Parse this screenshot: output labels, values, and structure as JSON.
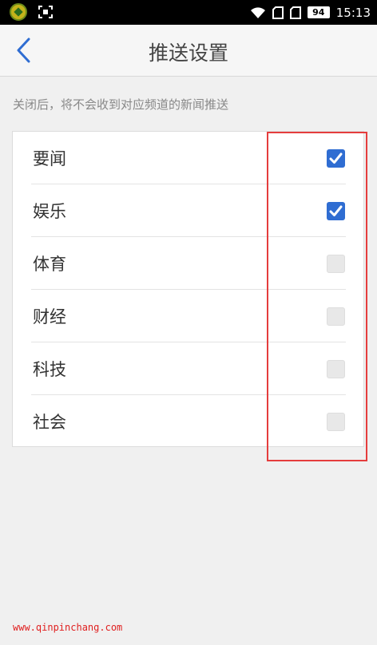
{
  "status_bar": {
    "battery": "94",
    "time": "15:13"
  },
  "header": {
    "title": "推送设置"
  },
  "hint": "关闭后，将不会收到对应频道的新闻推送",
  "channels": [
    {
      "label": "要闻",
      "checked": true
    },
    {
      "label": "娱乐",
      "checked": true
    },
    {
      "label": "体育",
      "checked": false
    },
    {
      "label": "财经",
      "checked": false
    },
    {
      "label": "科技",
      "checked": false
    },
    {
      "label": "社会",
      "checked": false
    }
  ],
  "colors": {
    "accent": "#2f6dd2",
    "highlight": "#e53d3d"
  },
  "watermark": "www.qinpinchang.com"
}
